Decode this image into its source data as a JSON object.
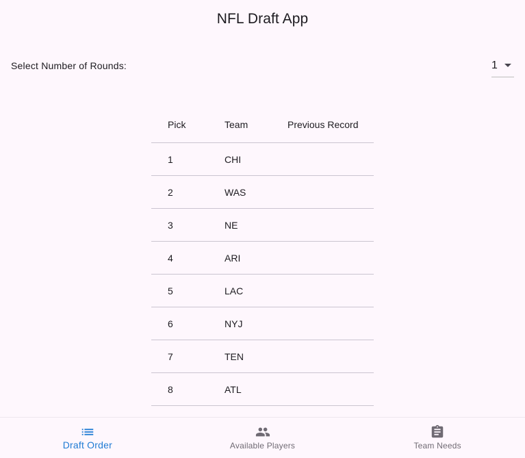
{
  "appbar": {
    "title": "NFL Draft App"
  },
  "rounds": {
    "label": "Select Number of Rounds:",
    "value": "1"
  },
  "table": {
    "headers": {
      "pick": "Pick",
      "team": "Team",
      "record": "Previous Record"
    },
    "rows": [
      {
        "pick": "1",
        "team": "CHI",
        "record": ""
      },
      {
        "pick": "2",
        "team": "WAS",
        "record": ""
      },
      {
        "pick": "3",
        "team": "NE",
        "record": ""
      },
      {
        "pick": "4",
        "team": "ARI",
        "record": ""
      },
      {
        "pick": "5",
        "team": "LAC",
        "record": ""
      },
      {
        "pick": "6",
        "team": "NYJ",
        "record": ""
      },
      {
        "pick": "7",
        "team": "TEN",
        "record": ""
      },
      {
        "pick": "8",
        "team": "ATL",
        "record": ""
      }
    ]
  },
  "nav": {
    "items": [
      {
        "label": "Draft Order",
        "icon": "list-icon",
        "active": true
      },
      {
        "label": "Available Players",
        "icon": "people-icon",
        "active": false
      },
      {
        "label": "Team Needs",
        "icon": "clipboard-icon",
        "active": false
      }
    ]
  },
  "colors": {
    "accent": "#1e7bd4",
    "background": "#fef7fd",
    "inactive": "#6f6a73"
  }
}
